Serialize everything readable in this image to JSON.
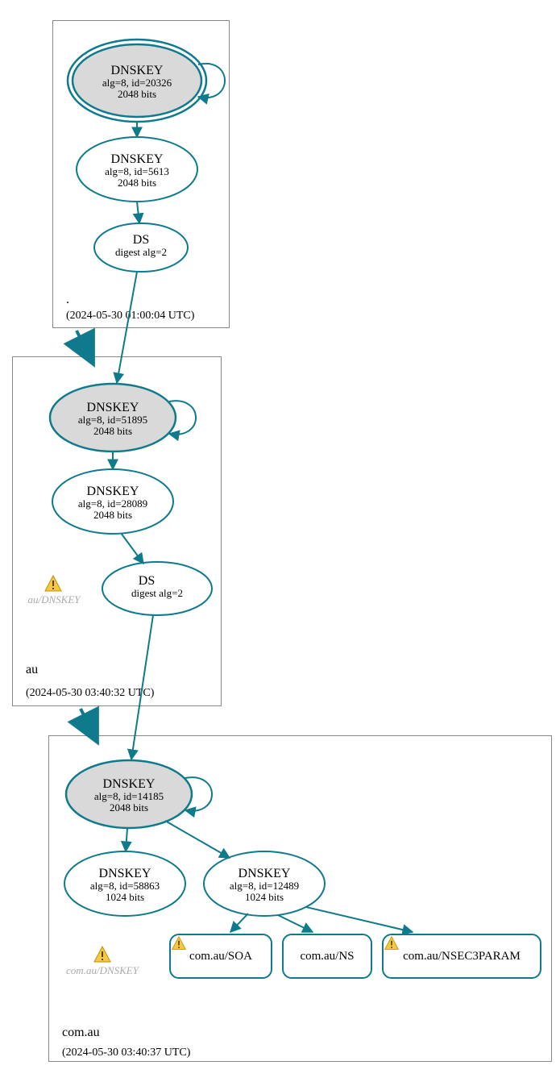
{
  "zones": {
    "root": {
      "label": ".",
      "timestamp": "(2024-05-30 01:00:04 UTC)"
    },
    "au": {
      "label": "au",
      "timestamp": "(2024-05-30 03:40:32 UTC)"
    },
    "comau": {
      "label": "com.au",
      "timestamp": "(2024-05-30 03:40:37 UTC)"
    }
  },
  "nodes": {
    "root_ksk": {
      "title": "DNSKEY",
      "l2": "alg=8, id=20326",
      "l3": "2048 bits"
    },
    "root_zsk": {
      "title": "DNSKEY",
      "l2": "alg=8, id=5613",
      "l3": "2048 bits"
    },
    "root_ds": {
      "title": "DS",
      "l2": "digest alg=2"
    },
    "au_ksk": {
      "title": "DNSKEY",
      "l2": "alg=8, id=51895",
      "l3": "2048 bits"
    },
    "au_zsk": {
      "title": "DNSKEY",
      "l2": "alg=8, id=28089",
      "l3": "2048 bits"
    },
    "au_ds": {
      "title": "DS",
      "l2": "digest alg=2"
    },
    "ca_ksk": {
      "title": "DNSKEY",
      "l2": "alg=8, id=14185",
      "l3": "2048 bits"
    },
    "ca_zsk1": {
      "title": "DNSKEY",
      "l2": "alg=8, id=58863",
      "l3": "1024 bits"
    },
    "ca_zsk2": {
      "title": "DNSKEY",
      "l2": "alg=8, id=12489",
      "l3": "1024 bits"
    }
  },
  "warnings": {
    "au_dnskey": "au/DNSKEY",
    "comau_dnskey": "com.au/DNSKEY"
  },
  "rrsets": {
    "soa": "com.au/SOA",
    "ns": "com.au/NS",
    "nsec3": "com.au/NSEC3PARAM"
  },
  "chart_data": {
    "type": "graph",
    "description": "DNSSEC delegation graph (DNSViz-style). Zones are rectangles; ellipses are DNSKEY/DS records; arrows are signing/delegation relationships; yellow triangles are warnings.",
    "zones": [
      {
        "name": ".",
        "timestamp": "2024-05-30 01:00:04 UTC"
      },
      {
        "name": "au",
        "timestamp": "2024-05-30 03:40:32 UTC"
      },
      {
        "name": "com.au",
        "timestamp": "2024-05-30 03:40:37 UTC"
      }
    ],
    "nodes": [
      {
        "id": "root_ksk",
        "zone": ".",
        "type": "DNSKEY",
        "alg": 8,
        "keyid": 20326,
        "bits": 2048,
        "ksk": true,
        "trust_anchor": true,
        "warning": false
      },
      {
        "id": "root_zsk",
        "zone": ".",
        "type": "DNSKEY",
        "alg": 8,
        "keyid": 5613,
        "bits": 2048,
        "ksk": false,
        "warning": false
      },
      {
        "id": "root_ds",
        "zone": ".",
        "type": "DS",
        "digest_alg": 2,
        "for_zone": "au",
        "warning": false
      },
      {
        "id": "au_ksk",
        "zone": "au",
        "type": "DNSKEY",
        "alg": 8,
        "keyid": 51895,
        "bits": 2048,
        "ksk": true,
        "warning": false
      },
      {
        "id": "au_zsk",
        "zone": "au",
        "type": "DNSKEY",
        "alg": 8,
        "keyid": 28089,
        "bits": 2048,
        "ksk": false,
        "warning": false
      },
      {
        "id": "au_ds",
        "zone": "au",
        "type": "DS",
        "digest_alg": 2,
        "for_zone": "com.au",
        "warning": true
      },
      {
        "id": "au_dnskey_hidden",
        "zone": "au",
        "type": "DNSKEY-placeholder",
        "label": "au/DNSKEY",
        "warning": true
      },
      {
        "id": "comau_ksk",
        "zone": "com.au",
        "type": "DNSKEY",
        "alg": 8,
        "keyid": 14185,
        "bits": 2048,
        "ksk": true,
        "warning": false
      },
      {
        "id": "comau_zsk1",
        "zone": "com.au",
        "type": "DNSKEY",
        "alg": 8,
        "keyid": 58863,
        "bits": 1024,
        "ksk": false,
        "warning": false
      },
      {
        "id": "comau_zsk2",
        "zone": "com.au",
        "type": "DNSKEY",
        "alg": 8,
        "keyid": 12489,
        "bits": 1024,
        "ksk": false,
        "warning": false
      },
      {
        "id": "comau_dnskey_hidden",
        "zone": "com.au",
        "type": "DNSKEY-placeholder",
        "label": "com.au/DNSKEY",
        "warning": true
      },
      {
        "id": "comau_soa",
        "zone": "com.au",
        "type": "RRset",
        "name": "com.au/SOA",
        "warning": true
      },
      {
        "id": "comau_ns",
        "zone": "com.au",
        "type": "RRset",
        "name": "com.au/NS",
        "warning": false
      },
      {
        "id": "comau_nsec3",
        "zone": "com.au",
        "type": "RRset",
        "name": "com.au/NSEC3PARAM",
        "warning": true
      }
    ],
    "edges": [
      {
        "from": "root_ksk",
        "to": "root_ksk",
        "kind": "self-sign"
      },
      {
        "from": "root_ksk",
        "to": "root_zsk",
        "kind": "signs"
      },
      {
        "from": "root_zsk",
        "to": "root_ds",
        "kind": "signs"
      },
      {
        "from": "root_ds",
        "to": "au_ksk",
        "kind": "delegates"
      },
      {
        "from": ".",
        "to": "au",
        "kind": "zone-delegation"
      },
      {
        "from": "au_ksk",
        "to": "au_ksk",
        "kind": "self-sign"
      },
      {
        "from": "au_ksk",
        "to": "au_zsk",
        "kind": "signs"
      },
      {
        "from": "au_zsk",
        "to": "au_ds",
        "kind": "signs"
      },
      {
        "from": "au_ds",
        "to": "comau_ksk",
        "kind": "delegates"
      },
      {
        "from": "au",
        "to": "com.au",
        "kind": "zone-delegation"
      },
      {
        "from": "comau_ksk",
        "to": "comau_ksk",
        "kind": "self-sign"
      },
      {
        "from": "comau_ksk",
        "to": "comau_zsk1",
        "kind": "signs"
      },
      {
        "from": "comau_ksk",
        "to": "comau_zsk2",
        "kind": "signs"
      },
      {
        "from": "comau_zsk2",
        "to": "comau_soa",
        "kind": "signs"
      },
      {
        "from": "comau_zsk2",
        "to": "comau_ns",
        "kind": "signs"
      },
      {
        "from": "comau_zsk2",
        "to": "comau_nsec3",
        "kind": "signs"
      }
    ]
  }
}
